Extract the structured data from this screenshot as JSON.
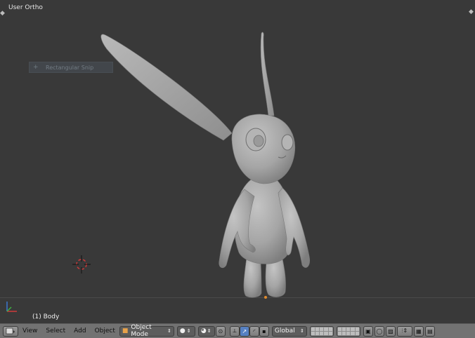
{
  "viewport": {
    "view_label": "User Ortho",
    "snap_tooltip": "Rectangular Snip",
    "object_label": "(1) Body"
  },
  "header": {
    "menus": [
      "View",
      "Select",
      "Add",
      "Object"
    ],
    "mode": "Object Mode",
    "orientation": "Global"
  },
  "colors": {
    "viewport_bg": "#393939",
    "header_bg": "#727272",
    "model": "#a8a8a8",
    "active_button": "#5680c2"
  }
}
